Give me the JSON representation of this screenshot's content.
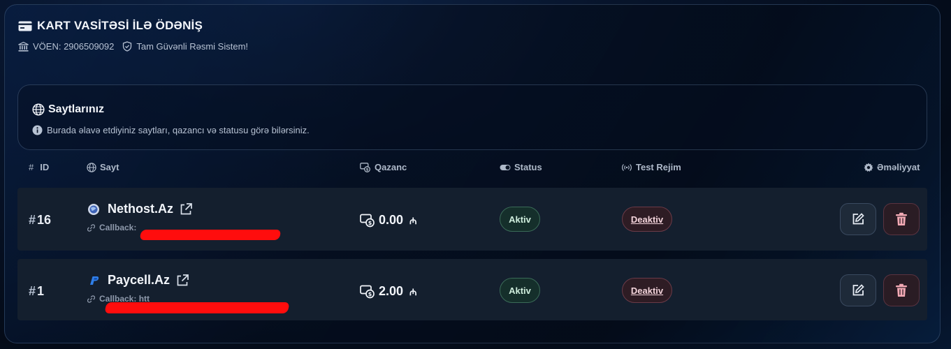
{
  "header": {
    "title": "KART VASİTƏSİ İLƏ ÖDƏNİŞ",
    "voen": "VÖEN: 2906509092",
    "secure_text": "Tam Güvənli Rəsmi Sistem!"
  },
  "info": {
    "title": "Saytlarınız",
    "description": "Burada əlavə etdiyiniz saytları, qazancı və statusu görə bilərsiniz."
  },
  "table": {
    "columns": {
      "id": "ID",
      "id_hash": "#",
      "site": "Sayt",
      "earnings": "Qazanc",
      "status": "Status",
      "test_mode": "Test Rejim",
      "actions": "Əməliyyat"
    },
    "rows": [
      {
        "hash": "#",
        "id": "16",
        "site_name": "Nethost.Az",
        "callback_label": "Callback:",
        "amount": "0.00",
        "currency": "₼",
        "status": "Aktiv",
        "test_mode": "Deaktiv"
      },
      {
        "hash": "#",
        "id": "1",
        "site_name": "Paycell.Az",
        "callback_label": "Callback: htt",
        "amount": "2.00",
        "currency": "₼",
        "status": "Aktiv",
        "test_mode": "Deaktiv"
      }
    ]
  },
  "icons": {
    "card": "card-icon",
    "bank": "bank-icon",
    "shield": "shield-icon",
    "globe": "globe-icon",
    "info": "info-icon",
    "money": "money-icon",
    "toggle": "toggle-icon",
    "signal": "signal-icon",
    "gear": "gear-icon",
    "external_link": "external-link-icon",
    "link": "link-icon",
    "edit": "edit-icon",
    "trash": "trash-icon"
  },
  "colors": {
    "active_green": "#cfeedd",
    "inactive_red": "#f2d3da",
    "redaction": "#ff0d0d"
  }
}
